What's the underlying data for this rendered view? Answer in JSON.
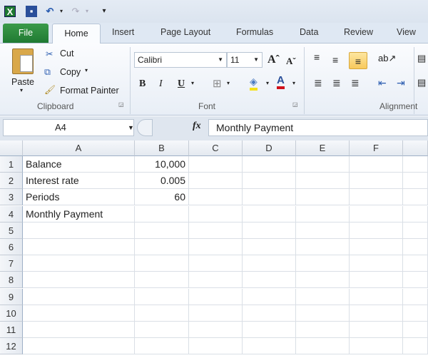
{
  "quick_access": {
    "icons": [
      "excel-logo-icon",
      "save-icon",
      "undo-icon",
      "redo-icon",
      "customize-icon"
    ]
  },
  "tabs": [
    "File",
    "Home",
    "Insert",
    "Page Layout",
    "Formulas",
    "Data",
    "Review",
    "View"
  ],
  "ribbon": {
    "clipboard": {
      "paste": "Paste",
      "cut": "Cut",
      "copy": "Copy",
      "format_painter": "Format Painter",
      "label": "Clipboard"
    },
    "font": {
      "name": "Calibri",
      "size": "11",
      "bold": "B",
      "italic": "I",
      "underline": "U",
      "label": "Font",
      "fill_color": "#f5e11a",
      "font_color": "#d0101a"
    },
    "alignment": {
      "label": "Alignment"
    }
  },
  "formula_bar": {
    "name_box": "A4",
    "fx": "fx",
    "content": "Monthly Payment"
  },
  "sheet": {
    "columns": [
      "A",
      "B",
      "C",
      "D",
      "E",
      "F"
    ],
    "rows": [
      "1",
      "2",
      "3",
      "4",
      "5",
      "6",
      "7",
      "8",
      "9",
      "10",
      "11",
      "12"
    ],
    "cells": [
      {
        "a": "Balance",
        "b": "10,000"
      },
      {
        "a": "Interest rate",
        "b": "0.005"
      },
      {
        "a": "Periods",
        "b": "60"
      },
      {
        "a": "Monthly Payment",
        "b": ""
      }
    ],
    "selected_cell": "A4"
  }
}
